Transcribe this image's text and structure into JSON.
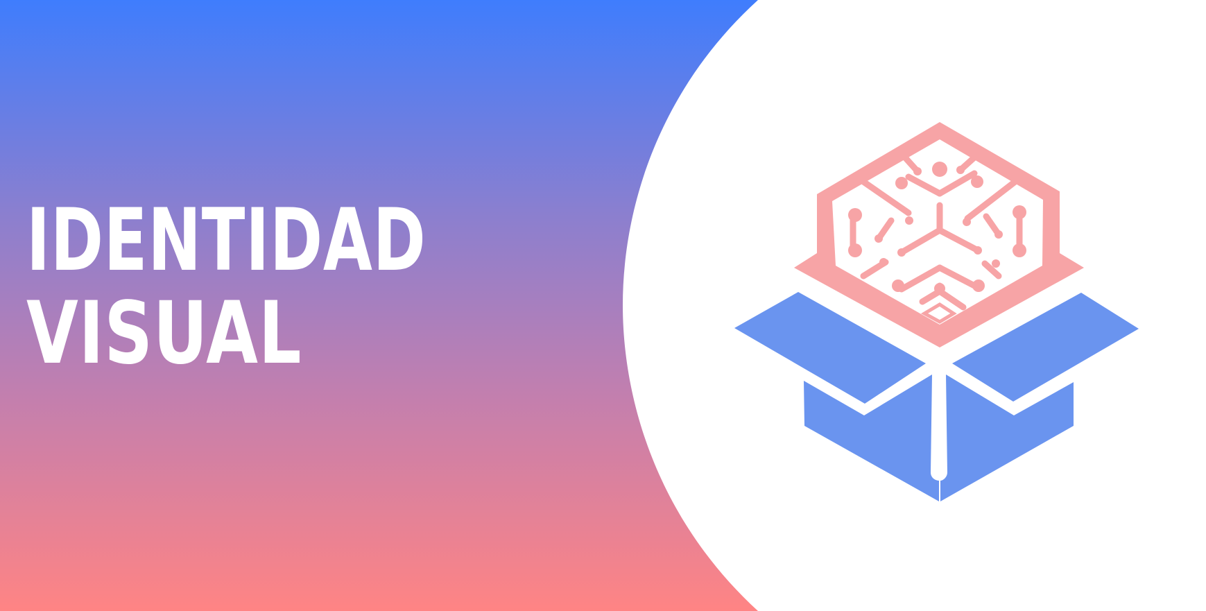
{
  "banner": {
    "title_line1": "IDENTIDAD",
    "title_line2": "VISUAL"
  },
  "colors": {
    "gradient_top": "#3f7dfd",
    "gradient_bottom": "#ff8484",
    "background": "#ffffff",
    "title_text": "#ffffff",
    "chip_pink": "#f7a4a6",
    "box_blue": "#6a94ef"
  },
  "logo": {
    "icon": "box-with-circuit-chip-icon"
  }
}
